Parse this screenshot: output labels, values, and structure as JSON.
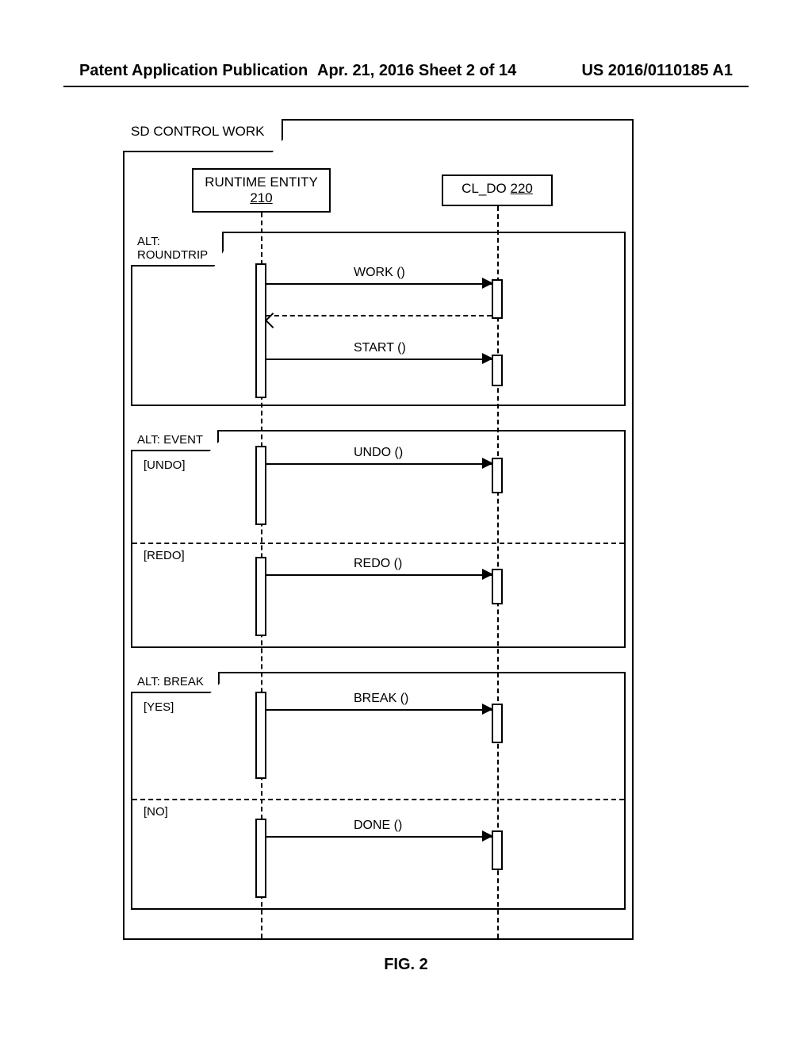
{
  "header": {
    "left": "Patent Application Publication",
    "mid": "Apr. 21, 2016  Sheet 2 of 14",
    "right": "US 2016/0110185 A1"
  },
  "diagram": {
    "title": "SD CONTROL WORK",
    "participants": {
      "runtime": {
        "label": "RUNTIME ENTITY",
        "id": "210"
      },
      "cldo": {
        "label": "CL_DO ",
        "id": "220"
      }
    },
    "fragments": {
      "roundtrip": {
        "tab": "ALT:\nROUNDTRIP"
      },
      "event": {
        "tab": "ALT: EVENT",
        "guard_undo": "[UNDO]",
        "guard_redo": "[REDO]"
      },
      "break": {
        "tab": "ALT: BREAK",
        "guard_yes": "[YES]",
        "guard_no": "[NO]"
      }
    },
    "messages": {
      "work": "WORK ()",
      "start": "START ()",
      "undo": "UNDO ()",
      "redo": "REDO ()",
      "break": "BREAK ()",
      "done": "DONE ()"
    }
  },
  "figure_caption": "FIG. 2"
}
